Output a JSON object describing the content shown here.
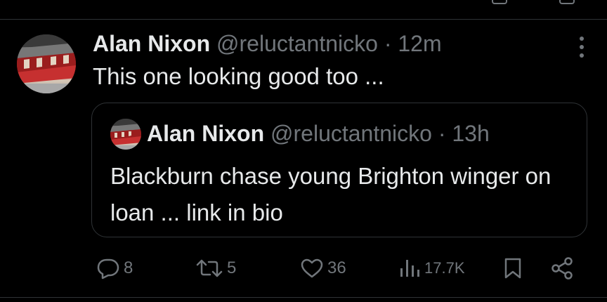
{
  "tweet": {
    "author_name": "Alan Nixon",
    "author_handle": "@reluctantnicko",
    "separator": "·",
    "time": "12m",
    "text": "This one looking good too ...",
    "avatar_icon": "stadium-avatar",
    "more_icon": "more-vertical-icon"
  },
  "quoted_tweet": {
    "author_name": "Alan Nixon",
    "author_handle": "@reluctantnicko",
    "separator": "·",
    "time": "13h",
    "text": "Blackburn chase young Brighton winger on loan ... link in bio",
    "avatar_icon": "stadium-avatar"
  },
  "actions": {
    "reply": {
      "icon": "reply-icon",
      "count": "8"
    },
    "retweet": {
      "icon": "retweet-icon",
      "count": "5"
    },
    "like": {
      "icon": "heart-icon",
      "count": "36"
    },
    "views": {
      "icon": "analytics-icon",
      "count": "17.7K"
    },
    "bookmark": {
      "icon": "bookmark-icon"
    },
    "share": {
      "icon": "share-icon"
    }
  },
  "colors": {
    "background": "#000000",
    "text_primary": "#e7e9ea",
    "text_secondary": "#71767b",
    "border": "#2f3336",
    "stadium_red": "#b92525"
  }
}
